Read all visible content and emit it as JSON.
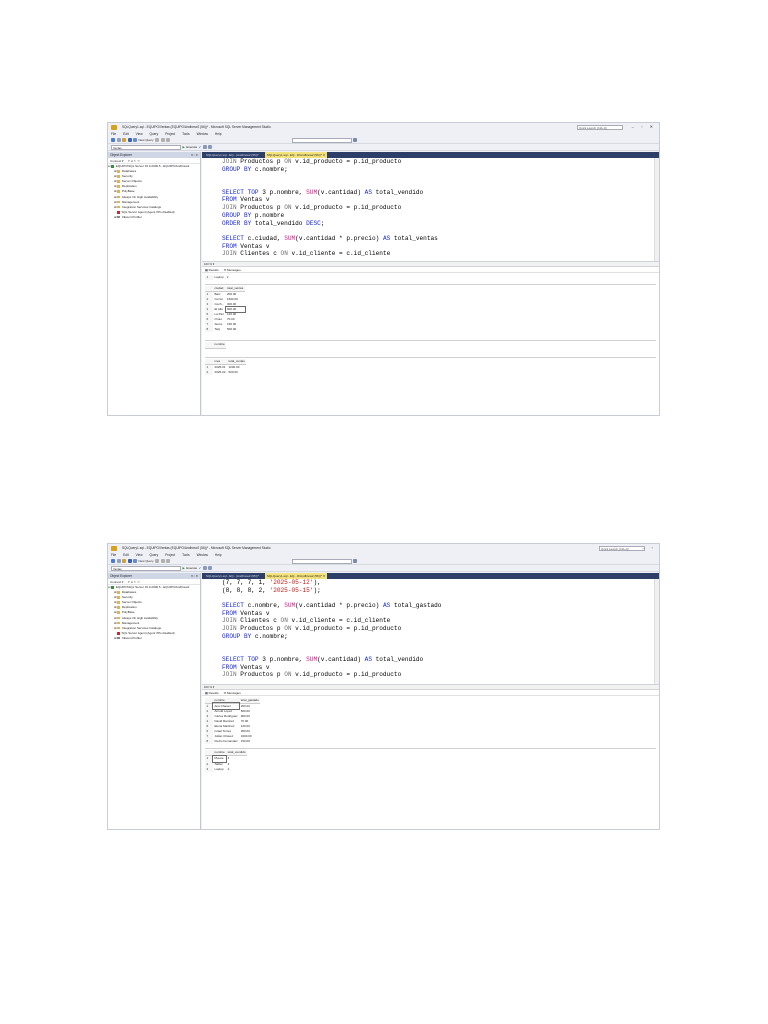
{
  "app": {
    "title": "SQLQuery1.sql - EQUIPO\\Ventas (EQUIPO\\Andhrew2 (56))* - Microsoft SQL Server Management Studio",
    "quick_launch": "Quick Launch (Ctrl+Q)",
    "menu": [
      "File",
      "Edit",
      "View",
      "Query",
      "Project",
      "Tools",
      "Window",
      "Help"
    ],
    "toolbar": {
      "new_query": "New Query",
      "database": "Ventas",
      "execute": "Execute"
    },
    "object_explorer": {
      "title": "Object Explorer",
      "connect": "Connect ▾",
      "server": "EQUIPO\\SQL Server 15.0.2000.5 - EQUIPO\\Andhrew2",
      "nodes": [
        "Databases",
        "Security",
        "Server Objects",
        "Replication",
        "PolyBase",
        "Always On High Availability",
        "Management",
        "Integration Services Catalogs",
        "SQL Server Agent (Agent XPs disabled)",
        "XEvent Profiler"
      ]
    },
    "tabs": [
      "SQLQuery1.sql - EQ...(Andhrew2 (65))*",
      "SQLQuery1.sql - EQ...O\\Andhrew2 (56))*"
    ],
    "zoom": "100 %",
    "results_tab": "Results",
    "messages_tab": "Messages"
  },
  "shot1": {
    "code": [
      [
        [
          "gy",
          "JOIN "
        ],
        [
          "",
          "Productos p "
        ],
        [
          "gy",
          "ON "
        ],
        [
          "",
          "v.id_producto = p.id_producto"
        ]
      ],
      [
        [
          "kw",
          "GROUP BY "
        ],
        [
          "",
          "c.nombre;"
        ]
      ],
      [],
      [],
      [
        [
          "kw",
          "SELECT TOP "
        ],
        [
          "",
          "3 p.nombre, "
        ],
        [
          "fn",
          "SUM"
        ],
        [
          "",
          "(v.cantidad) "
        ],
        [
          "kw",
          "AS "
        ],
        [
          "",
          "total_vendido"
        ]
      ],
      [
        [
          "kw",
          "FROM "
        ],
        [
          "",
          "Ventas v"
        ]
      ],
      [
        [
          "gy",
          "JOIN "
        ],
        [
          "",
          "Productos p "
        ],
        [
          "gy",
          "ON "
        ],
        [
          "",
          "v.id_producto = p.id_producto"
        ]
      ],
      [
        [
          "kw",
          "GROUP BY "
        ],
        [
          "",
          "p.nombre"
        ]
      ],
      [
        [
          "kw",
          "ORDER BY "
        ],
        [
          "",
          "total_vendido "
        ],
        [
          "kw",
          "DESC"
        ],
        [
          "",
          ";"
        ]
      ],
      [],
      [
        [
          "kw",
          "SELECT "
        ],
        [
          "",
          "c.ciudad, "
        ],
        [
          "fn",
          "SUM"
        ],
        [
          "",
          "(v.cantidad * p.precio) "
        ],
        [
          "kw",
          "AS "
        ],
        [
          "",
          "total_ventas"
        ]
      ],
      [
        [
          "kw",
          "FROM "
        ],
        [
          "",
          "Ventas v"
        ]
      ],
      [
        [
          "gy",
          "JOIN "
        ],
        [
          "",
          "Clientes c "
        ],
        [
          "gy",
          "ON "
        ],
        [
          "",
          "v.id_cliente = c.id_cliente"
        ]
      ]
    ],
    "grid_top": {
      "rows": [
        [
          "1",
          "Laptop",
          "2"
        ]
      ]
    },
    "grid_city": {
      "headers": [
        "ciudad",
        "total_ventas"
      ],
      "rows": [
        [
          "1",
          "Barc",
          "200.00"
        ],
        [
          "2",
          "Cuzco",
          "1600.00"
        ],
        [
          "3",
          "Coch...",
          "300.00"
        ],
        [
          "4",
          "El Alto",
          "900.00"
        ],
        [
          "5",
          "La Paz",
          "120.00"
        ],
        [
          "6",
          "Oruro",
          "70.00"
        ],
        [
          "7",
          "Sucre",
          "150.00"
        ],
        [
          "8",
          "Tarij",
          "500.00"
        ]
      ]
    },
    "grid_nombre": {
      "headers": [
        "nombre"
      ]
    },
    "grid_mes": {
      "headers": [
        "mes",
        "total_ventas"
      ],
      "rows": [
        [
          "1",
          "2025-01",
          "1000.00"
        ],
        [
          "2",
          "2025-02",
          "600.00"
        ]
      ]
    }
  },
  "shot2": {
    "code": [
      [
        [
          "",
          "(7, 7, 7, 1, "
        ],
        [
          "st",
          "'2025-05-12'"
        ],
        [
          "",
          "),"
        ]
      ],
      [
        [
          "",
          "(8, 8, 8, 2, "
        ],
        [
          "st",
          "'2025-05-15'"
        ],
        [
          "",
          ");"
        ]
      ],
      [],
      [
        [
          "kw",
          "SELECT "
        ],
        [
          "",
          "c.nombre, "
        ],
        [
          "fn",
          "SUM"
        ],
        [
          "",
          "(v.cantidad * p.precio) "
        ],
        [
          "kw",
          "AS "
        ],
        [
          "",
          "total_gastado"
        ]
      ],
      [
        [
          "kw",
          "FROM "
        ],
        [
          "",
          "Ventas v"
        ]
      ],
      [
        [
          "gy",
          "JOIN "
        ],
        [
          "",
          "Clientes c "
        ],
        [
          "gy",
          "ON "
        ],
        [
          "",
          "v.id_cliente = c.id_cliente"
        ]
      ],
      [
        [
          "gy",
          "JOIN "
        ],
        [
          "",
          "Productos p "
        ],
        [
          "gy",
          "ON "
        ],
        [
          "",
          "v.id_producto = p.id_producto"
        ]
      ],
      [
        [
          "kw",
          "GROUP BY "
        ],
        [
          "",
          "c.nombre;"
        ]
      ],
      [],
      [],
      [
        [
          "kw",
          "SELECT TOP "
        ],
        [
          "",
          "3 p.nombre, "
        ],
        [
          "fn",
          "SUM"
        ],
        [
          "",
          "(v.cantidad) "
        ],
        [
          "kw",
          "AS "
        ],
        [
          "",
          "total_vendido"
        ]
      ],
      [
        [
          "kw",
          "FROM "
        ],
        [
          "",
          "Ventas v"
        ]
      ],
      [
        [
          "gy",
          "JOIN "
        ],
        [
          "",
          "Productos p "
        ],
        [
          "gy",
          "ON "
        ],
        [
          "",
          "v.id_producto = p.id_producto"
        ]
      ]
    ],
    "grid_gastado": {
      "headers": [
        "nombre",
        "total_gastado"
      ],
      "rows": [
        [
          "1",
          "Ana Chavez",
          "200.00"
        ],
        [
          "2",
          "Arnold Lopez",
          "500.00"
        ],
        [
          "3",
          "Carlos Rodriguez",
          "900.00"
        ],
        [
          "4",
          "David Ramirez",
          "70.00"
        ],
        [
          "5",
          "Elena Martinez",
          "120.00"
        ],
        [
          "6",
          "Israel Torres",
          "300.00"
        ],
        [
          "7",
          "Julian Chavez",
          "1600.00"
        ],
        [
          "8",
          "Pedro Fernandez",
          "150.00"
        ]
      ]
    },
    "grid_vendido": {
      "headers": [
        "nombre",
        "total_vendido"
      ],
      "rows": [
        [
          "1",
          "Mouse",
          "4"
        ],
        [
          "2",
          "Tablet",
          "3"
        ],
        [
          "3",
          "Laptop",
          "2"
        ]
      ]
    }
  }
}
